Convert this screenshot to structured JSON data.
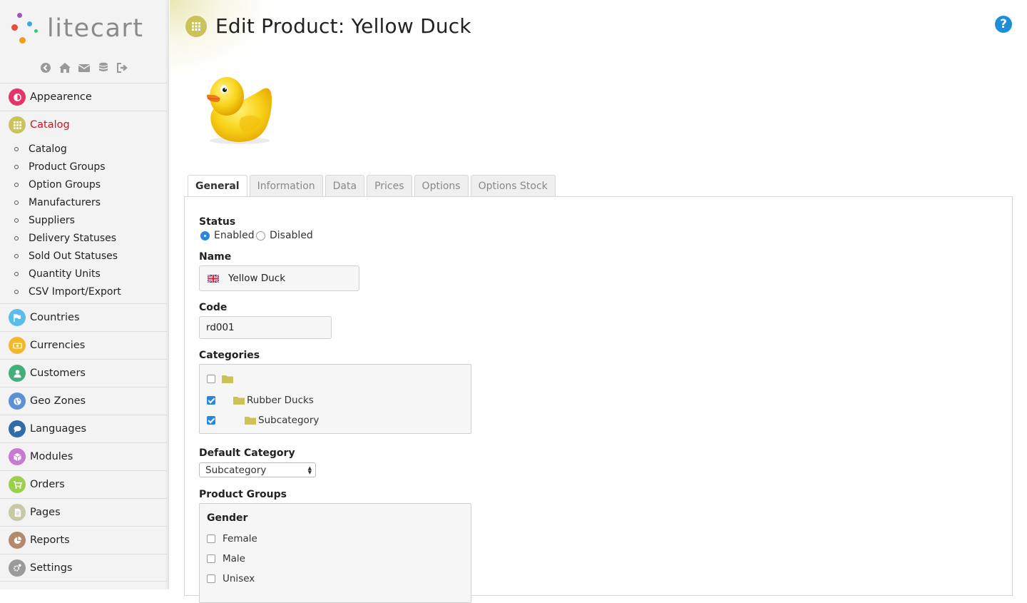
{
  "brand": {
    "name": "litecart"
  },
  "shortcuts": [
    "back-icon",
    "home-icon",
    "mail-icon",
    "database-icon",
    "logout-icon"
  ],
  "sidebar": {
    "items": [
      {
        "label": "Appearence",
        "icon": "appearance-icon",
        "color": "#e5356b"
      },
      {
        "label": "Catalog",
        "icon": "grid-icon",
        "color": "#c9c35a",
        "active": true,
        "sub": [
          "Catalog",
          "Product Groups",
          "Option Groups",
          "Manufacturers",
          "Suppliers",
          "Delivery Statuses",
          "Sold Out Statuses",
          "Quantity Units",
          "CSV Import/Export"
        ]
      },
      {
        "label": "Countries",
        "icon": "flag-icon",
        "color": "#5bbcec"
      },
      {
        "label": "Currencies",
        "icon": "money-icon",
        "color": "#f3b72b"
      },
      {
        "label": "Customers",
        "icon": "user-icon",
        "color": "#43b07b"
      },
      {
        "label": "Geo Zones",
        "icon": "globe-icon",
        "color": "#5b8fd6"
      },
      {
        "label": "Languages",
        "icon": "comments-icon",
        "color": "#2f6ca8"
      },
      {
        "label": "Modules",
        "icon": "cube-icon",
        "color": "#c57bd1"
      },
      {
        "label": "Orders",
        "icon": "cart-icon",
        "color": "#9ccf4a"
      },
      {
        "label": "Pages",
        "icon": "file-icon",
        "color": "#c8c8a8"
      },
      {
        "label": "Reports",
        "icon": "pie-chart-icon",
        "color": "#b48a6e"
      },
      {
        "label": "Settings",
        "icon": "cogs-icon",
        "color": "#9a9a9a"
      }
    ]
  },
  "page": {
    "title": "Edit Product: Yellow Duck",
    "help": "?"
  },
  "tabs": [
    "General",
    "Information",
    "Data",
    "Prices",
    "Options",
    "Options Stock"
  ],
  "form": {
    "status_label": "Status",
    "status_options": [
      "Enabled",
      "Disabled"
    ],
    "status_selected": "Enabled",
    "name_label": "Name",
    "name_value": "Yellow Duck",
    "code_label": "Code",
    "code_value": "rd001",
    "categories_label": "Categories",
    "categories": [
      {
        "name": "",
        "checked": false
      },
      {
        "name": "Rubber Ducks",
        "checked": true
      },
      {
        "name": "Subcategory",
        "checked": true
      }
    ],
    "default_category_label": "Default Category",
    "default_category_value": "Subcategory",
    "product_groups_label": "Product Groups",
    "group_name": "Gender",
    "group_values": [
      "Female",
      "Male",
      "Unisex"
    ]
  }
}
